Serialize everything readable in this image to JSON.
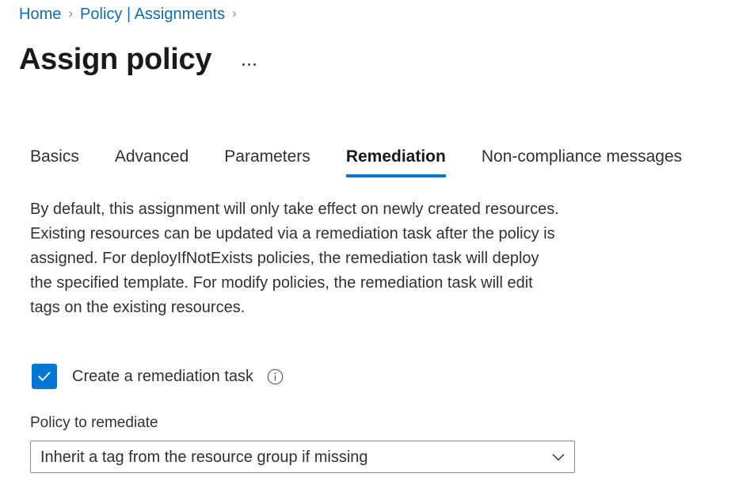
{
  "breadcrumb": {
    "items": [
      {
        "label": "Home"
      },
      {
        "label": "Policy | Assignments"
      }
    ],
    "separator": "›"
  },
  "header": {
    "title": "Assign policy",
    "more_options_label": "..."
  },
  "tabs": [
    {
      "label": "Basics",
      "active": false
    },
    {
      "label": "Advanced",
      "active": false
    },
    {
      "label": "Parameters",
      "active": false
    },
    {
      "label": "Remediation",
      "active": true
    },
    {
      "label": "Non-compliance messages",
      "active": false
    }
  ],
  "main": {
    "description": "By default, this assignment will only take effect on newly created resources. Existing resources can be updated via a remediation task after the policy is assigned. For deployIfNotExists policies, the remediation task will deploy the specified template. For modify policies, the remediation task will edit tags on the existing resources.",
    "checkbox": {
      "label": "Create a remediation task",
      "checked": true,
      "info_icon": "info-circle-icon"
    },
    "policy_field": {
      "label": "Policy to remediate",
      "value": "Inherit a tag from the resource group if missing",
      "chevron_icon": "chevron-down-icon"
    }
  },
  "colors": {
    "accent": "#0078d4",
    "link": "#0f6cbd",
    "text": "#323130",
    "title": "#1b1a19",
    "border": "#8a8886"
  }
}
